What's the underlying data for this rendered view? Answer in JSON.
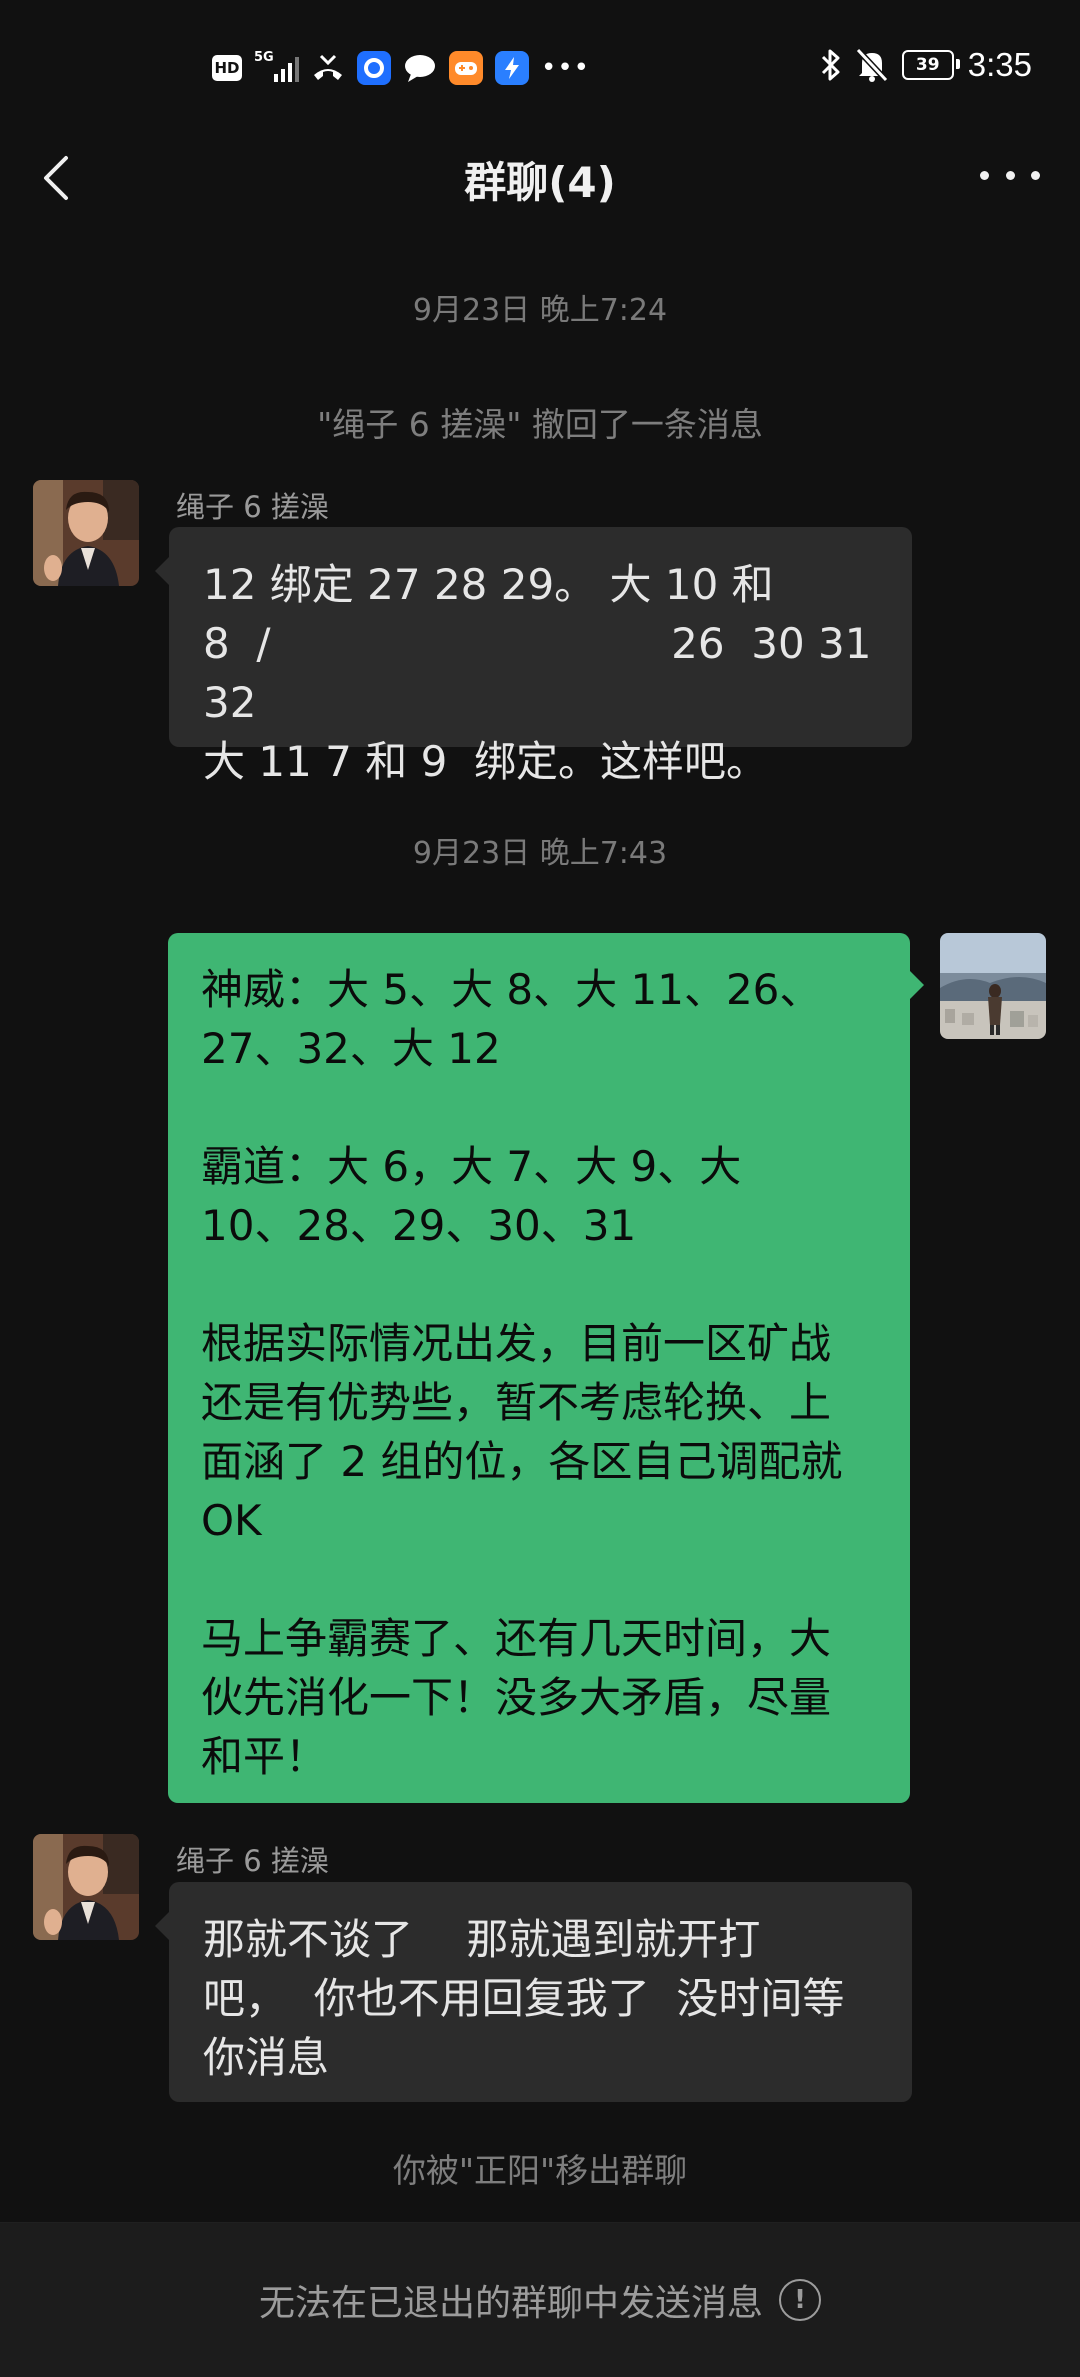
{
  "status_bar": {
    "hd_label": "HD",
    "network_label": "5G",
    "time": "3:35",
    "battery_level": "39",
    "icons": [
      "hd-icon",
      "signal-icon",
      "missed-call-icon",
      "app-blue-icon",
      "message-bubble-icon",
      "game-app-icon",
      "bolt-app-icon",
      "more-notifications-icon",
      "bluetooth-icon",
      "mute-bell-icon",
      "battery-icon"
    ]
  },
  "header": {
    "title": "群聊(4)",
    "back_icon": "chevron-left-icon",
    "more_icon": "more-dots-icon"
  },
  "messages": {
    "timestamp_1": "9月23日 晚上7:24",
    "recall_notice": "\"绳子 6 搓澡\" 撤回了一条消息",
    "msg1": {
      "sender": "绳子 6 搓澡",
      "text": "12 绑定 27 28 29。 大 10 和\n8  /                              26  30 31 32\n大 11 7 和 9  绑定。这样吧。"
    },
    "timestamp_2": "9月23日 晚上7:43",
    "msg2": {
      "text": "神威：大 5、大 8、大 11、26、\n27、32、大 12\n\n霸道：大 6，大 7、大 9、大\n10、28、29、30、31\n\n根据实际情况出发，目前一区矿战\n还是有优势些，暂不考虑轮换、上\n面涵了 2 组的位，各区自己调配就\nOK\n\n马上争霸赛了、还有几天时间，大\n伙先消化一下！没多大矛盾，尽量\n和平！"
    },
    "msg3": {
      "sender": "绳子 6 搓澡",
      "text": "那就不谈了    那就遇到就开打\n吧，  你也不用回复我了  没时间等\n你消息"
    },
    "removed_notice": "你被\"正阳\"移出群聊"
  },
  "footer": {
    "text": "无法在已退出的群聊中发送消息",
    "info_icon": "!"
  },
  "colors": {
    "background": "#111111",
    "incoming_bubble": "#2c2c2c",
    "outgoing_bubble": "#3fb673",
    "footer": "#1c1c1c"
  }
}
